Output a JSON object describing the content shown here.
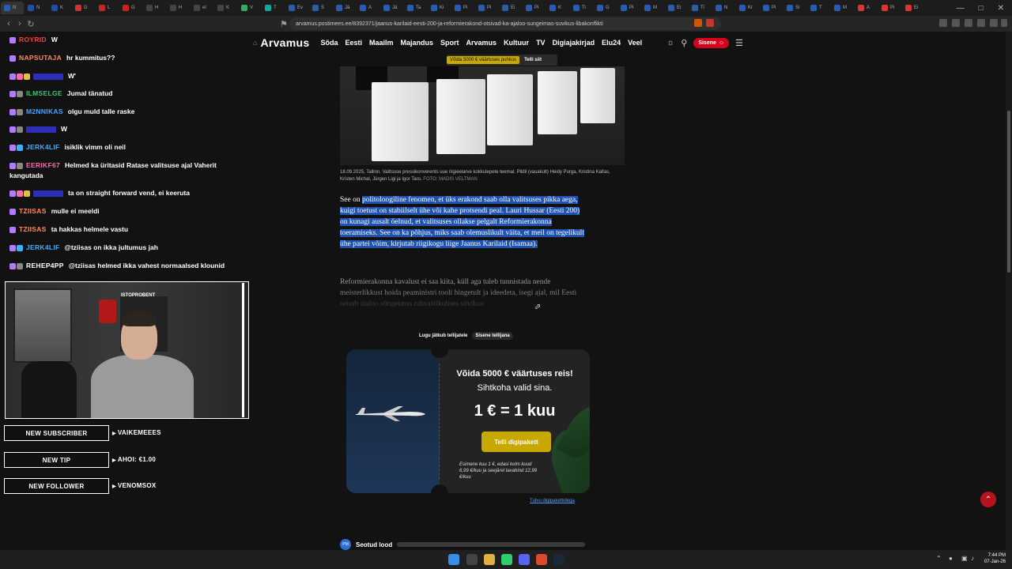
{
  "browser": {
    "tabs": [
      {
        "label": "N",
        "color": "#2a5db0"
      },
      {
        "label": "N",
        "color": "#1e4fa0"
      },
      {
        "label": "K",
        "color": "#1e4fa0"
      },
      {
        "label": "G",
        "color": "#c33"
      },
      {
        "label": "L",
        "color": "#c22"
      },
      {
        "label": "G",
        "color": "#c22"
      },
      {
        "label": "H",
        "color": "#444"
      },
      {
        "label": "H",
        "color": "#444"
      },
      {
        "label": "el",
        "color": "#444"
      },
      {
        "label": "K",
        "color": "#444"
      },
      {
        "label": "V",
        "color": "#3a6"
      },
      {
        "label": "T",
        "color": "#1a9"
      },
      {
        "label": "Ev",
        "color": "#2a5db0"
      },
      {
        "label": "S",
        "color": "#2a5db0"
      },
      {
        "label": "Jä",
        "color": "#2a5db0"
      },
      {
        "label": "A",
        "color": "#2a5db0"
      },
      {
        "label": "Jä",
        "color": "#2a5db0"
      },
      {
        "label": "Ta",
        "color": "#2a5db0"
      },
      {
        "label": "Ki",
        "color": "#2a5db0"
      },
      {
        "label": "Pi",
        "color": "#2a5db0"
      },
      {
        "label": "Pi",
        "color": "#2a5db0"
      },
      {
        "label": "Ei",
        "color": "#2a5db0"
      },
      {
        "label": "Pi",
        "color": "#2a5db0"
      },
      {
        "label": "K",
        "color": "#2a5db0"
      },
      {
        "label": "Ti",
        "color": "#2a5db0"
      },
      {
        "label": "G",
        "color": "#2a5db0"
      },
      {
        "label": "Pi",
        "color": "#2a5db0"
      },
      {
        "label": "M",
        "color": "#2a5db0"
      },
      {
        "label": "Ei",
        "color": "#2a5db0"
      },
      {
        "label": "Ti",
        "color": "#2a5db0"
      },
      {
        "label": "N",
        "color": "#2a5db0"
      },
      {
        "label": "Kr",
        "color": "#2a5db0"
      },
      {
        "label": "Pi",
        "color": "#2a5db0"
      },
      {
        "label": "Si",
        "color": "#2a5db0"
      },
      {
        "label": "T",
        "color": "#2a5db0"
      },
      {
        "label": "M",
        "color": "#2a5db0"
      },
      {
        "label": "A",
        "color": "#d33"
      },
      {
        "label": "Pi",
        "color": "#d33"
      },
      {
        "label": "Ei",
        "color": "#d33"
      },
      {
        "label": "Ti",
        "color": "#2a5db0"
      }
    ],
    "url": "arvamus.postimees.ee/8392371/jaanus-karilaid-eesti-200-ja-reformierakond-otsivad-ka-ajaloo-sungeimas-suvikus-libakonflikti"
  },
  "site": {
    "logo": "Arvamus",
    "nav": [
      "Sõda",
      "Eesti",
      "Maailm",
      "Majandus",
      "Sport",
      "Arvamus",
      "Kultuur",
      "TV",
      "Digiajakirjad",
      "Elu24",
      "Veel"
    ],
    "login": "Sisene",
    "promo_text": "Võida 5000 € väärtuses puhkus",
    "promo_button": "Telli siit"
  },
  "article": {
    "caption": "18.09.2025, Tallinn. Valitsuse pressikonverents uue riigieelarve kokkulepete teemal. Pildil (vasakult) Heidy Purga, Kristina Kallas, Kristen Michal, Jürgen Ligi ja Igor Taro.",
    "credit": "FOTO: MADIS VELTMAN",
    "lead_plain": "See on ",
    "lead_highlight": "politoloogiline fenomen, et üks erakond saab olla valitsuses pikka aega, kuigi toetust on stabiilselt ühe või kahe protsendi peal. Lauri Hussar (Eesti 200) on kunagi ausalt öelnud, et valitsuses ollakse pelgalt Reformierakonna toeramiseks. See on ka põhjus, miks saab olemuslikult väita, et meil on tegelikult ühe partei võim, kirjutab riigikogu liige Jaanus Karilaid (Isamaa).",
    "body": "Reformierakonna kavalust ei saa kiita, küll aga tuleb tunnistada nende meisterlikkust hoida peaministri tooli hingetult ja ideedeta, isegi ajal, mil Eesti seisab ajaloo süngeimas rahvastikulises süvikus.",
    "paywall_text": "Lugu jätkub tellijatele",
    "paywall_login": "Sisene tellijana"
  },
  "promo_card": {
    "title_line1": "Võida 5000 € väärtuses reis!",
    "title_line2": "Sihtkoha valid sina.",
    "price": "1 € = 1 kuu",
    "button": "Telli digipakett",
    "fine_print": "Esimene kuu 1 €, edasi kolm kuud 6,99 €/kuu ja seejärel tavahind 12,99 €/kuu",
    "link": "Tutvu digipakettidega"
  },
  "related": {
    "label": "Seotud lood",
    "logo": "PM"
  },
  "chat": {
    "messages": [
      {
        "user": "ROYRID",
        "user_color": "#ff3b3b",
        "text": "W",
        "badges": [
          "#b07bff"
        ]
      },
      {
        "user": "NAPSUTAJA",
        "user_color": "#ff8a5c",
        "text": "hr kummitus??",
        "badges": [
          "#b07bff"
        ]
      },
      {
        "user": "",
        "user_color": "#3b3bff",
        "text": "W'",
        "badges": [
          "#b07bff",
          "#ff69b4",
          "#e0c040"
        ]
      },
      {
        "user": "ILMSELGE",
        "user_color": "#2ecc71",
        "text": "Jumal tänatud",
        "badges": [
          "#b07bff",
          "#888"
        ]
      },
      {
        "user": "M2NNIKAS",
        "user_color": "#4aa3ff",
        "text": "olgu muld talle raske",
        "badges": [
          "#b07bff",
          "#888"
        ]
      },
      {
        "user": "",
        "user_color": "#3b3bff",
        "text": "W",
        "badges": [
          "#b07bff",
          "#888"
        ]
      },
      {
        "user": "JERK4LIF",
        "user_color": "#3ab0ff",
        "text": "isiklik vimm oli neil",
        "badges": [
          "#b07bff",
          "#3ab0ff"
        ]
      },
      {
        "user": "EERIKF67",
        "user_color": "#ff69b4",
        "text": "Helmed ka üritasid Ratase valitsuse ajal Vaherit kangutada",
        "badges": [
          "#b07bff",
          "#888"
        ]
      },
      {
        "user": "",
        "user_color": "#3b3bff",
        "text": "ta on straight forward vend, ei keeruta",
        "badges": [
          "#b07bff",
          "#ff69b4",
          "#e0c040"
        ]
      },
      {
        "user": "TZIISAS",
        "user_color": "#ff8a5c",
        "text": "mulle ei meeldi",
        "badges": [
          "#b07bff"
        ]
      },
      {
        "user": "TZIISAS",
        "user_color": "#ff8a5c",
        "text": "ta hakkas helmele vastu",
        "badges": [
          "#b07bff"
        ]
      },
      {
        "user": "JERK4LIF",
        "user_color": "#3ab0ff",
        "text": "@tziisas on ikka jultumus jah",
        "badges": [
          "#b07bff",
          "#3ab0ff"
        ]
      },
      {
        "user": "REHEP4PP",
        "user_color": "#ffffff",
        "text": "@tziisas helmed ikka vahest normaalsed klounid",
        "badges": [
          "#b07bff",
          "#888"
        ]
      }
    ]
  },
  "webcam": {
    "sign": "ISTOPROBENT"
  },
  "alerts": [
    {
      "label": "NEW SUBSCRIBER",
      "value": "VAIKEMEEES"
    },
    {
      "label": "NEW TIP",
      "value": "AHOI: €1.00"
    },
    {
      "label": "NEW FOLLOWER",
      "value": "VENOMSOX"
    }
  ],
  "taskbar": {
    "time": "7:44 PM",
    "date": "07-Jan-26"
  },
  "colors": {
    "accent_red": "#d5001c",
    "gold": "#c6a800",
    "highlight": "#2052b0"
  }
}
